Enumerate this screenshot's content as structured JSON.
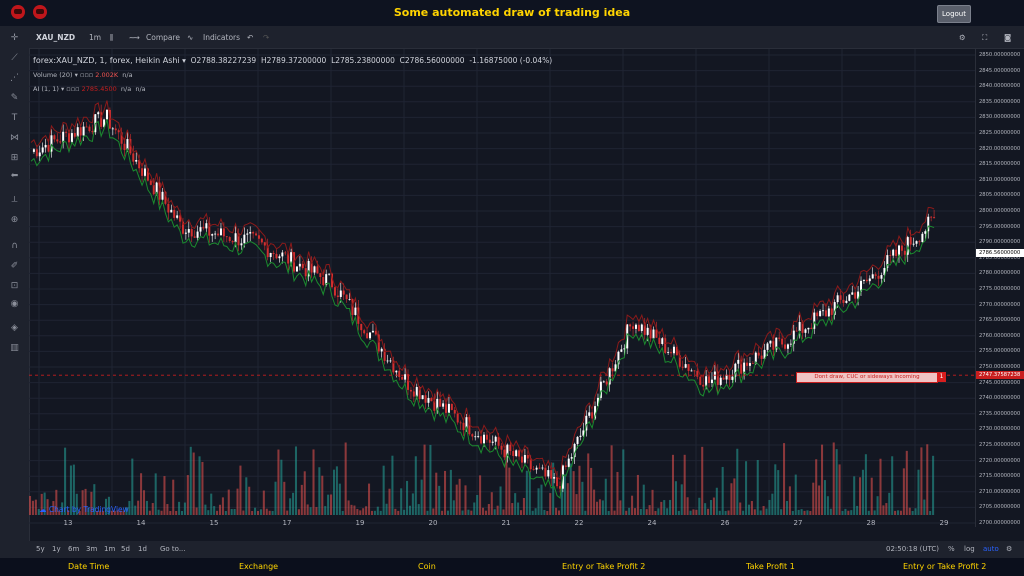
{
  "header": {
    "title": "Some automated draw of trading idea",
    "logout_label": "Logout"
  },
  "toolbar": {
    "symbol": "XAU_NZD",
    "interval": "1m",
    "compare_label": "Compare",
    "indicators_label": "Indicators"
  },
  "legend": {
    "main": "forex:XAU_NZD, 1, forex, Heikin Ashi",
    "open": "O2788.38227239",
    "high": "H2789.37200000",
    "low": "L2785.23800000",
    "close": "C2786.56000000",
    "change": "-1.16875000 (-0.04%)",
    "volume_label": "Volume (20)",
    "volume_val": "2.002K",
    "volume_na": "n/a",
    "ai_label": "AI (1, 1)",
    "ai_val": "2785.4500",
    "ai_na1": "n/a",
    "ai_na2": "n/a"
  },
  "price_axis": {
    "ticks": [
      "2850.00000000",
      "2845.00000000",
      "2840.00000000",
      "2835.00000000",
      "2830.00000000",
      "2825.00000000",
      "2820.00000000",
      "2815.00000000",
      "2810.00000000",
      "2805.00000000",
      "2800.00000000",
      "2795.00000000",
      "2790.00000000",
      "2785.00000000",
      "2780.00000000",
      "2775.00000000",
      "2770.00000000",
      "2765.00000000",
      "2760.00000000",
      "2755.00000000",
      "2750.00000000",
      "2745.00000000",
      "2740.00000000",
      "2735.00000000",
      "2730.00000000",
      "2725.00000000",
      "2720.00000000",
      "2715.00000000",
      "2710.00000000",
      "2705.00000000",
      "2700.00000000"
    ],
    "current_label": "2786.56000000",
    "line_label": "2747.37587238"
  },
  "time_axis": [
    "13",
    "14",
    "15",
    "17",
    "19",
    "20",
    "21",
    "22",
    "24",
    "26",
    "27",
    "28",
    "29"
  ],
  "annotation": {
    "text": "Dont draw, CUC or sideways incoming",
    "flag": "1"
  },
  "bottom": {
    "ranges": [
      "5y",
      "1y",
      "6m",
      "3m",
      "1m",
      "5d",
      "1d"
    ],
    "goto": "Go to...",
    "clock": "02:50:18 (UTC)",
    "pct": "%",
    "log": "log",
    "auto": "auto"
  },
  "tradingview": "Chart by TradingView",
  "footer": [
    "Date Time",
    "Exchange",
    "Coin",
    "Entry or Take Profit 2",
    "Take Profit 1",
    "Entry or Take Profit 2"
  ],
  "chart_data": {
    "type": "line",
    "y_range": [
      2700,
      2850
    ],
    "x": [
      "13",
      "14",
      "15",
      "17",
      "19",
      "20",
      "21",
      "22",
      "24",
      "26",
      "27",
      "28",
      "29"
    ],
    "series": [
      {
        "name": "forex:XAU_NZD, 1, forex, Heikin Ashi",
        "values": [
          2819,
          2830,
          2795,
          2790,
          2777,
          2745,
          2728,
          2712,
          2765,
          2745,
          2758,
          2775,
          2797
        ]
      }
    ],
    "horizontal_line": 2747.37587238,
    "colors": {
      "up": "#ffffff",
      "down": "#d32f2f",
      "ma_green": "#1b8a2e",
      "ma_red": "#8b1a1a",
      "vol_up": "#26a69a",
      "vol_down": "#ef5350"
    }
  }
}
